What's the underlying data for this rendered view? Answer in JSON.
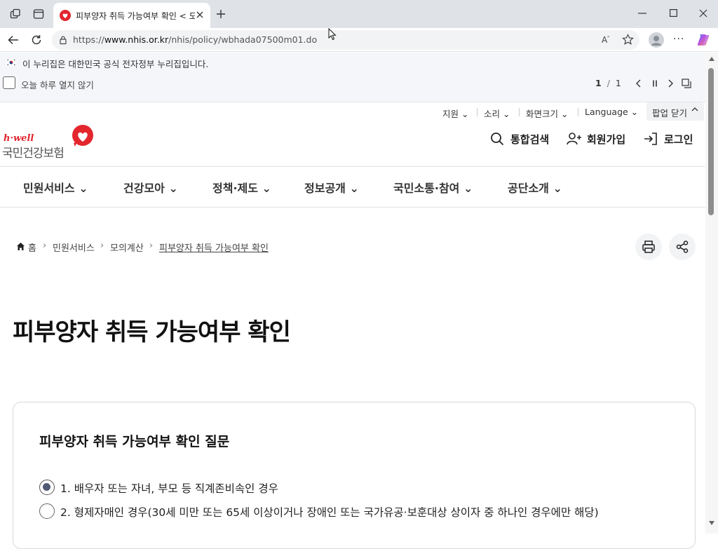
{
  "browser": {
    "tab_title": "피부양자 취득 가능여부 확인 < 도",
    "url_prefix": "https://",
    "url_host": "www.nhis.or.kr",
    "url_path": "/nhis/policy/wbhada07500m01.do"
  },
  "gov_banner": {
    "text": "이 누리집은 대한민국 공식 전자정부 누리집입니다."
  },
  "popup_bar": {
    "dont_show_today": "오늘 하루 열지 않기",
    "page_current": "1",
    "page_sep": "/",
    "page_total": "1"
  },
  "utility": {
    "support": "지원",
    "news": "소리",
    "screen_size": "화면크기",
    "language": "Language",
    "close_popup": "팝업 닫기"
  },
  "logo": {
    "brand": "h·well",
    "name": "국민건강보험"
  },
  "top_actions": {
    "search": "통합검색",
    "signup": "회원가입",
    "login": "로그인"
  },
  "nav": {
    "items": [
      "민원서비스",
      "건강모아",
      "정책·제도",
      "정보공개",
      "국민소통·참여",
      "공단소개"
    ]
  },
  "breadcrumb": {
    "home": "홈",
    "level1": "민원서비스",
    "level2": "모의계산",
    "current": "피부양자 취득 가능여부 확인"
  },
  "page": {
    "title": "피부양자 취득 가능여부 확인"
  },
  "question": {
    "title": "피부양자 취득 가능여부 확인 질문",
    "options": [
      {
        "label": "1. 배우자 또는 자녀, 부모 등 직계존비속인 경우",
        "selected": true
      },
      {
        "label": "2. 형제자매인 경우(30세 미만 또는 65세 이상이거나 장애인 또는 국가유공·보훈대상 상이자 중 하나인 경우에만 해당)",
        "selected": false
      }
    ]
  },
  "colors": {
    "brand_red": "#e3262e",
    "radio_fill": "#515a73"
  }
}
